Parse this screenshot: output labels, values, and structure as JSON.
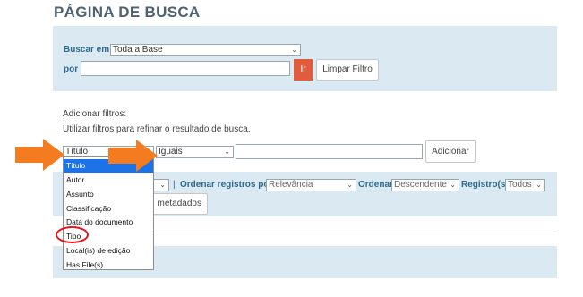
{
  "page": {
    "title": "PÁGINA DE BUSCA"
  },
  "search": {
    "buscar_em_label": "Buscar em:",
    "buscar_em_value": "Toda a Base",
    "por_label": "por",
    "por_value": "",
    "ir_button": "Ir",
    "limpar_button": "Limpar Filtro"
  },
  "filters": {
    "heading": "Adicionar filtros:",
    "help": "Utilizar filtros para refinar o resultado de busca.",
    "field_value": "Título",
    "operator_value": "Iguais",
    "term_value": "",
    "add_button": "Adicionar"
  },
  "sort": {
    "separator": "|",
    "order_by_label": "Ordenar registros por",
    "order_by_value": "Relevância",
    "order_label": "Ordenar",
    "order_value": "Descendente",
    "records_label": "Registro(s)",
    "records_value": "Todos",
    "metadata_button_partial": "metadados"
  },
  "dropdown": {
    "options": [
      "Título",
      "Autor",
      "Assunto",
      "Classificação",
      "Data do documento",
      "Tipo",
      "Local(is) de edição",
      "Has File(s)"
    ],
    "selected_index": 0,
    "highlighted_option": "Tipo"
  },
  "colors": {
    "title": "#4e6272",
    "panel_bg": "#dbeaf2",
    "label": "#2d6a8c",
    "ir_button": "#e15b3c",
    "dropdown_selected": "#1c73e8",
    "arrow": "#f47b20",
    "circle": "#e8141b"
  },
  "icons": [
    "chevron-down-icon",
    "arrow-right-icon"
  ]
}
